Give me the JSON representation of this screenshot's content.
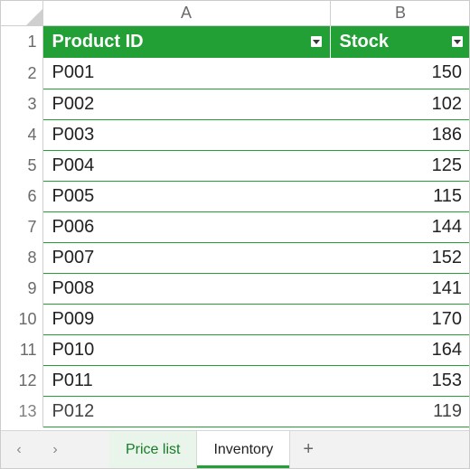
{
  "columns": [
    "A",
    "B"
  ],
  "table": {
    "headers": {
      "product_id": "Product ID",
      "stock": "Stock"
    }
  },
  "rows": [
    {
      "n": "1"
    },
    {
      "n": "2",
      "pid": "P001",
      "stock": "150"
    },
    {
      "n": "3",
      "pid": "P002",
      "stock": "102"
    },
    {
      "n": "4",
      "pid": "P003",
      "stock": "186"
    },
    {
      "n": "5",
      "pid": "P004",
      "stock": "125"
    },
    {
      "n": "6",
      "pid": "P005",
      "stock": "115"
    },
    {
      "n": "7",
      "pid": "P006",
      "stock": "144"
    },
    {
      "n": "8",
      "pid": "P007",
      "stock": "152"
    },
    {
      "n": "9",
      "pid": "P008",
      "stock": "141"
    },
    {
      "n": "10",
      "pid": "P009",
      "stock": "170"
    },
    {
      "n": "11",
      "pid": "P010",
      "stock": "164"
    },
    {
      "n": "12",
      "pid": "P011",
      "stock": "153"
    },
    {
      "n": "13",
      "pid": "P012",
      "stock": "119"
    }
  ],
  "tabs": {
    "prev": "‹",
    "next": "›",
    "sheet1": "Price list",
    "sheet2": "Inventory",
    "add": "+"
  }
}
